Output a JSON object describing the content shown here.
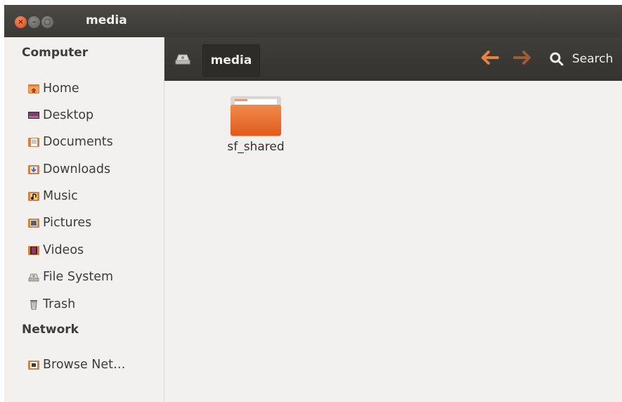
{
  "window": {
    "title": "media",
    "controls": {
      "close": "×",
      "minimize": "–",
      "maximize": "▢"
    }
  },
  "sidebar": {
    "sections": [
      {
        "header": "Computer",
        "items": [
          {
            "label": "Home",
            "icon": "home-folder-icon"
          },
          {
            "label": "Desktop",
            "icon": "desktop-icon"
          },
          {
            "label": "Documents",
            "icon": "documents-folder-icon"
          },
          {
            "label": "Downloads",
            "icon": "downloads-folder-icon"
          },
          {
            "label": "Music",
            "icon": "music-folder-icon"
          },
          {
            "label": "Pictures",
            "icon": "pictures-folder-icon"
          },
          {
            "label": "Videos",
            "icon": "videos-folder-icon"
          },
          {
            "label": "File System",
            "icon": "drive-icon"
          },
          {
            "label": "Trash",
            "icon": "trash-icon"
          }
        ]
      },
      {
        "header": "Network",
        "items": [
          {
            "label": "Browse Net…",
            "icon": "network-folder-icon"
          }
        ]
      }
    ]
  },
  "toolbar": {
    "path": [
      "media"
    ],
    "search_label": "Search"
  },
  "content": {
    "items": [
      {
        "name": "sf_shared",
        "type": "folder"
      }
    ]
  },
  "colors": {
    "accent": "#e1591e",
    "toolbar_bg": "#3a3935",
    "content_bg": "#f2f1f0"
  }
}
